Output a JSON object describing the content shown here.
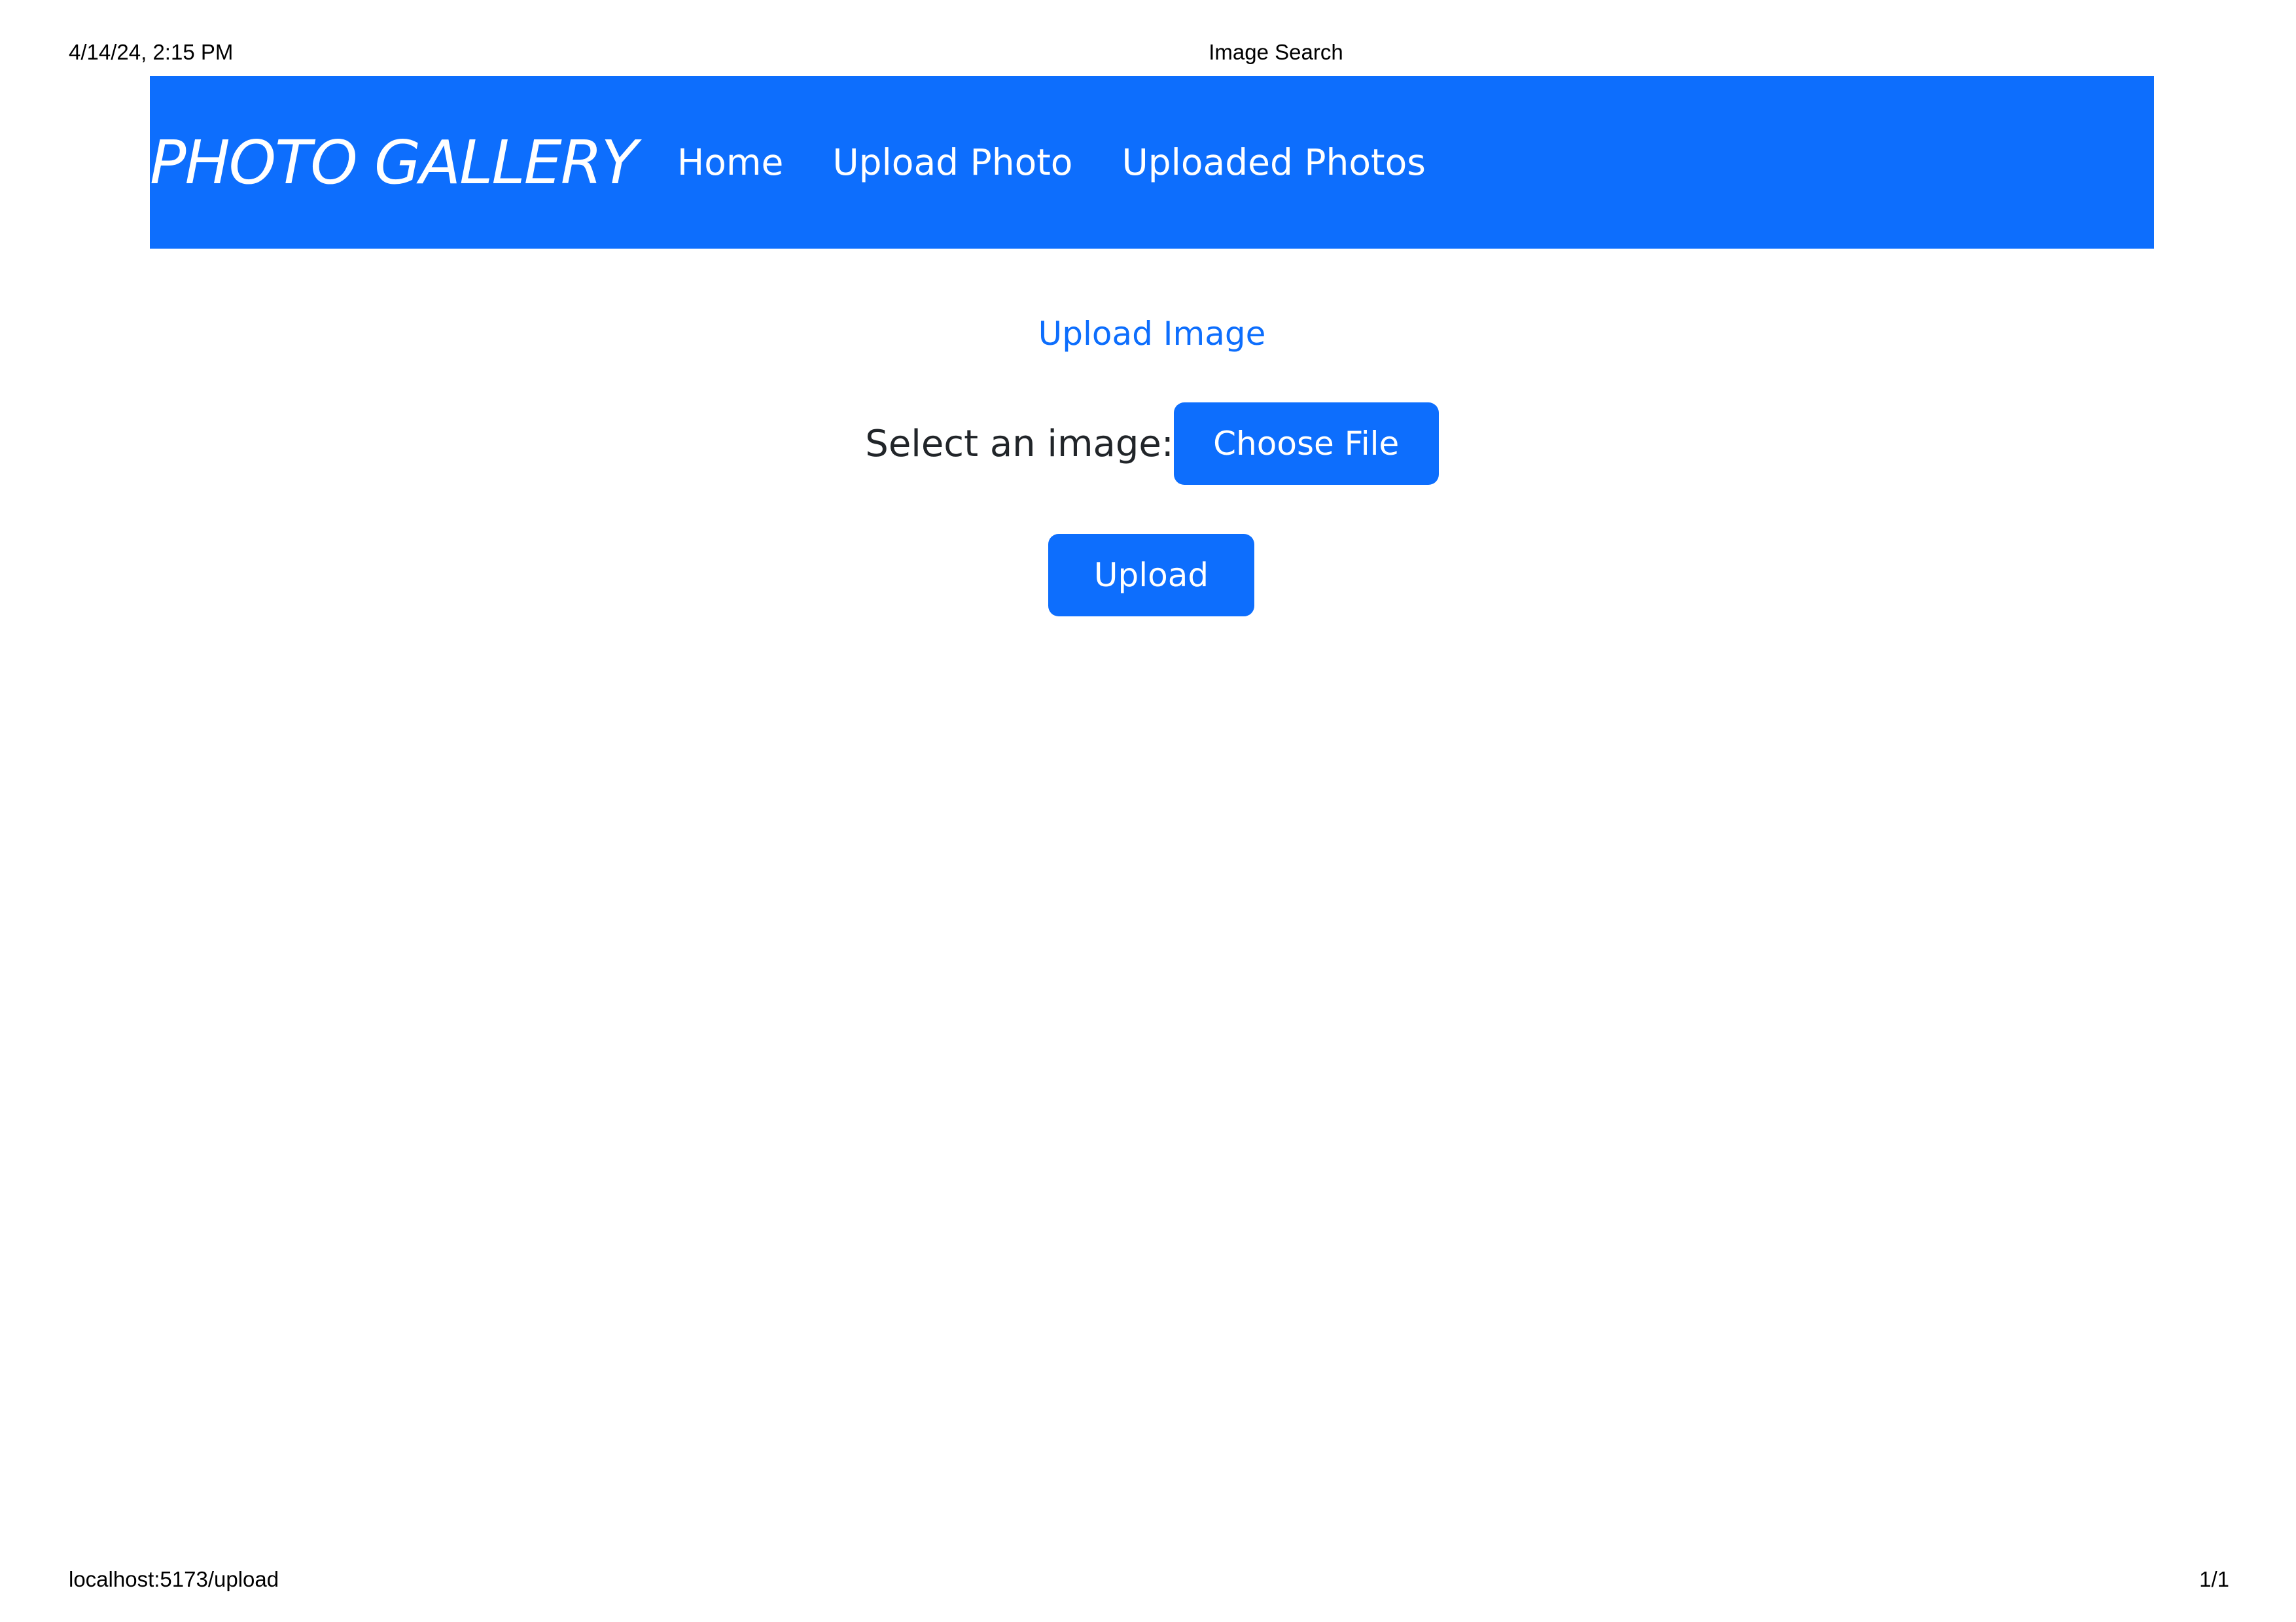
{
  "print_header": {
    "datetime": "4/14/24, 2:15 PM",
    "title": "Image Search"
  },
  "print_footer": {
    "url": "localhost:5173/upload",
    "page": "1/1"
  },
  "navbar": {
    "brand": "PHOTO GALLERY",
    "links": [
      "Home",
      "Upload Photo",
      "Uploaded Photos"
    ]
  },
  "main": {
    "title": "Upload Image",
    "select_label": "Select an image:",
    "choose_file_label": "Choose File",
    "upload_label": "Upload"
  },
  "colors": {
    "primary": "#0d6efd",
    "text": "#212529"
  }
}
